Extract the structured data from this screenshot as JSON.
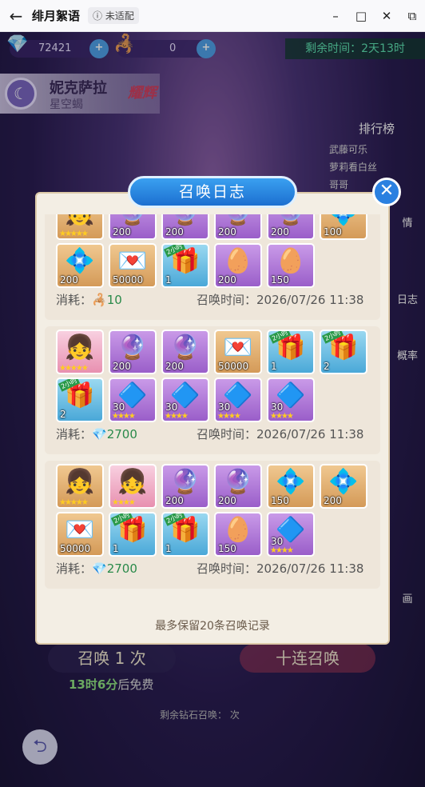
{
  "window": {
    "title": "绯月絮语",
    "badge": "未适配",
    "back_icon": "arrow-left-icon",
    "min": "–",
    "max": "□",
    "close": "✕",
    "side": "⧉"
  },
  "resources": {
    "diamonds": "72421",
    "scorpions": "0",
    "remaining_time": "剩余时间：2天13时"
  },
  "hero": {
    "name": "妮克萨拉",
    "subtitle": "星空蝎",
    "tag": "耀辉"
  },
  "ranking": {
    "title": "排行榜",
    "entries": [
      "武藤可乐",
      "萝莉看白丝",
      "哥哥"
    ]
  },
  "side_labels": [
    "情",
    "日志",
    "概率",
    "画"
  ],
  "bottom": {
    "summon_once": "召唤 1 次",
    "summon_ten": "十连召唤",
    "free_time": "13时6分",
    "free_suffix": "后免费",
    "diamond_text": "剩余钻石召唤：",
    "diamond_count": "次"
  },
  "dialog": {
    "title": "召唤日志",
    "close_icon": "close-icon",
    "footnote": "最多保留20条召唤记录",
    "records": [
      {
        "cost_label": "消耗：",
        "cost_value": "10",
        "time": "召唤时间：2026/07/26 11:38",
        "items": [
          {
            "type": "char",
            "qty": "",
            "stars": "★★★★★",
            "color": "gold"
          },
          {
            "type": "orb",
            "qty": "200",
            "color": "purple"
          },
          {
            "type": "orb",
            "qty": "200",
            "color": "purple"
          },
          {
            "type": "orb",
            "qty": "200",
            "color": "purple"
          },
          {
            "type": "orb",
            "qty": "200",
            "color": "purple"
          },
          {
            "type": "crystal",
            "qty": "100",
            "color": "gold"
          },
          {
            "type": "crystal",
            "qty": "200",
            "color": "gold"
          },
          {
            "type": "card",
            "qty": "50000",
            "color": "gold"
          },
          {
            "type": "chest",
            "qty": "1",
            "tag": "2小时",
            "color": "blue"
          },
          {
            "type": "egg",
            "qty": "200",
            "color": "purple"
          },
          {
            "type": "egg",
            "qty": "150",
            "color": "purple"
          }
        ]
      },
      {
        "cost_label": "消耗：",
        "cost_value": "2700",
        "time": "召唤时间：2026/07/26 11:38",
        "items": [
          {
            "type": "char",
            "qty": "",
            "stars": "★★★★★",
            "color": "pink"
          },
          {
            "type": "orb",
            "qty": "200",
            "color": "purple"
          },
          {
            "type": "orb",
            "qty": "200",
            "color": "purple"
          },
          {
            "type": "card",
            "qty": "50000",
            "color": "gold"
          },
          {
            "type": "chest",
            "qty": "1",
            "tag": "2小时",
            "color": "blue"
          },
          {
            "type": "chest",
            "qty": "2",
            "tag": "2小时",
            "color": "blue"
          },
          {
            "type": "chest",
            "qty": "2",
            "tag": "2小时",
            "color": "blue"
          },
          {
            "type": "gem",
            "qty": "30",
            "stars": "★★★★",
            "color": "purple"
          },
          {
            "type": "gem",
            "qty": "30",
            "stars": "★★★★",
            "color": "purple"
          },
          {
            "type": "gem",
            "qty": "30",
            "stars": "★★★★",
            "color": "purple"
          },
          {
            "type": "gem",
            "qty": "30",
            "stars": "★★★★",
            "color": "purple"
          }
        ]
      },
      {
        "cost_label": "消耗：",
        "cost_value": "2700",
        "time": "召唤时间：2026/07/26 11:38",
        "items": [
          {
            "type": "char",
            "qty": "",
            "stars": "★★★★★",
            "color": "gold"
          },
          {
            "type": "char",
            "qty": "",
            "stars": "★★★★",
            "color": "pink"
          },
          {
            "type": "orb",
            "qty": "200",
            "color": "purple"
          },
          {
            "type": "orb",
            "qty": "200",
            "color": "purple"
          },
          {
            "type": "crystal",
            "qty": "150",
            "color": "gold"
          },
          {
            "type": "crystal",
            "qty": "200",
            "color": "gold"
          },
          {
            "type": "card",
            "qty": "50000",
            "color": "gold"
          },
          {
            "type": "chest",
            "qty": "1",
            "tag": "2小时",
            "color": "blue"
          },
          {
            "type": "chest",
            "qty": "1",
            "tag": "2小时",
            "color": "blue"
          },
          {
            "type": "egg",
            "qty": "150",
            "color": "purple"
          },
          {
            "type": "gem",
            "qty": "30",
            "stars": "★★★★",
            "color": "purple"
          }
        ]
      }
    ]
  }
}
